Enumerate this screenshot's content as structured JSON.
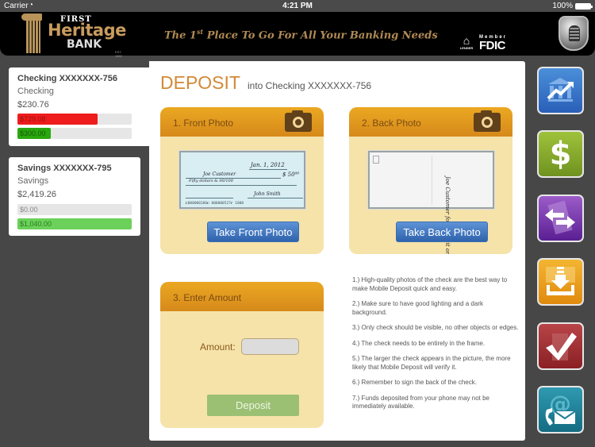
{
  "status_bar": {
    "carrier": "Carrier",
    "wifi_icon": "wifi-icon",
    "time": "4:21 PM",
    "battery": "100%"
  },
  "banner": {
    "logo": {
      "first": "FIRST",
      "heritage": "Heritage",
      "bank": "BANK",
      "est": "EST. 1882"
    },
    "tagline_pre": "The 1",
    "tagline_sup": "st",
    "tagline_post": " Place To Go For All Your Banking Needs",
    "equal_housing": {
      "icon": "equal-housing-icon",
      "text": "LENDER"
    },
    "fdic": {
      "member": "Member",
      "name": "FDIC"
    },
    "lock_icon": "lock-shield-icon"
  },
  "accounts": [
    {
      "title": "Checking XXXXXXX-756",
      "type": "Checking",
      "balance": "$230.76",
      "selected": true,
      "bars": [
        {
          "label": "$729.08",
          "fraction": 0.7,
          "color": "#ee1c1c",
          "text_color": "#a01010"
        },
        {
          "label": "$300.00",
          "fraction": 0.29,
          "color": "#2aa80f",
          "text_color": "#145a08"
        }
      ]
    },
    {
      "title": "Savings XXXXXXX-795",
      "type": "Savings",
      "balance": "$2,419.26",
      "selected": false,
      "bars": [
        {
          "label": "$0.00",
          "fraction": 0.0,
          "color": "#d6d6d6",
          "text_color": "#888888"
        },
        {
          "label": "$1,040.00",
          "fraction": 1.0,
          "color": "#6bd15a",
          "text_color": "#2d7a22"
        }
      ]
    }
  ],
  "deposit": {
    "title": "DEPOSIT",
    "subtitle": "into Checking XXXXXXX-756",
    "front": {
      "header": "1. Front Photo",
      "button": "Take Front Photo",
      "check": {
        "date": "Jan. 1, 2012",
        "payee": "Joe Customer",
        "amount": "$ 50⁰⁰",
        "written": "Fifty dollars & 00/100",
        "signature": "John Smith",
        "micr": "⑆000000186⑆  000000527⑈  1000"
      }
    },
    "back": {
      "header": "2. Back Photo",
      "button": "Take Back Photo",
      "endorsement": "Joe Customer for deposit only"
    },
    "amount": {
      "header": "3. Enter Amount",
      "label": "Amount:",
      "value": "",
      "button": "Deposit"
    },
    "tips": [
      "1.) High-quality photos of the check are the best way to make Mobile Deposit quick and easy.",
      "2.) Make sure to have good lighting and a dark background.",
      "3.) Only check should be visible, no other objects or edges.",
      "4.) The check needs to be entirely in the frame.",
      "5.) The larger the check appears in the picture, the more likely that Mobile Deposit will verify it.",
      "6.) Remember to sign the back of the check.",
      "7.) Funds deposited from your phone may not be immediately available."
    ]
  },
  "nav": [
    {
      "name": "accounts-nav-button",
      "icon": "bank-growth-icon",
      "color_top": "#4a8fd9",
      "color_bottom": "#2a5fb8"
    },
    {
      "name": "bill-pay-nav-button",
      "icon": "dollar-icon",
      "color_top": "#9fc23c",
      "color_bottom": "#6f9220"
    },
    {
      "name": "transfer-nav-button",
      "icon": "transfer-arrows-icon",
      "color_top": "#9c5cc9",
      "color_bottom": "#5a1f93"
    },
    {
      "name": "deposit-nav-button",
      "icon": "deposit-download-icon",
      "color_top": "#f3b531",
      "color_bottom": "#e08a0e"
    },
    {
      "name": "checklist-nav-button",
      "icon": "checkmark-icon",
      "color_top": "#b84548",
      "color_bottom": "#8a1f24"
    },
    {
      "name": "contact-nav-button",
      "icon": "phone-mail-icon",
      "color_top": "#2f9ab1",
      "color_bottom": "#146c82"
    }
  ]
}
